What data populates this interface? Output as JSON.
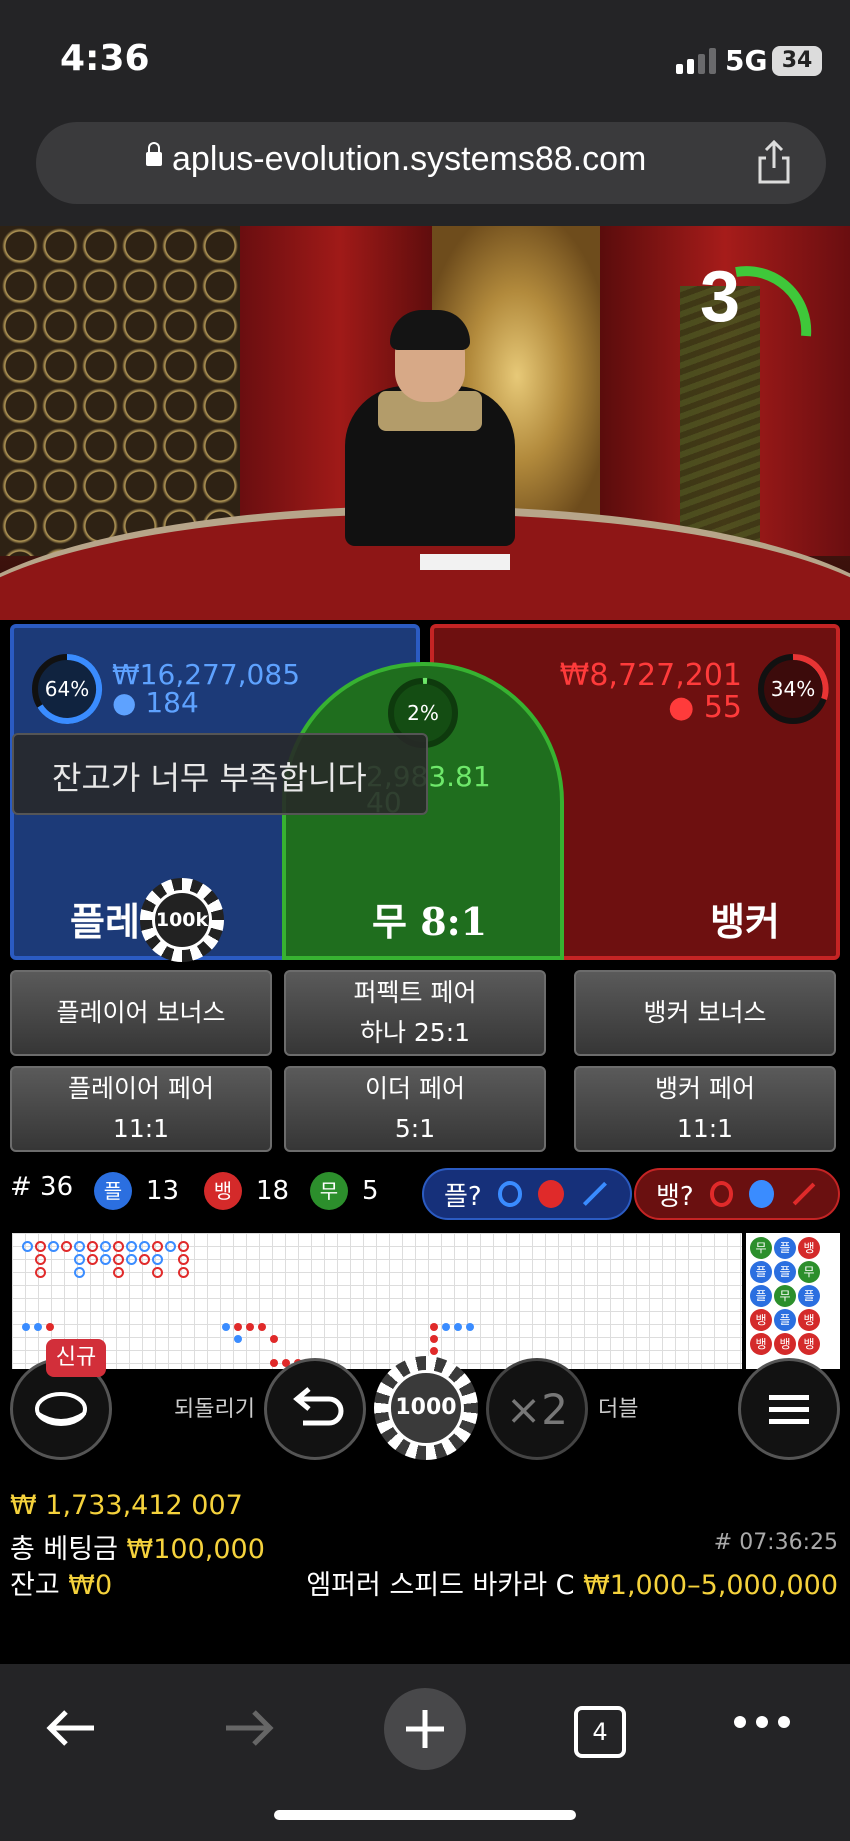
{
  "status": {
    "time": "4:36",
    "network": "5G",
    "battery": "34"
  },
  "browser": {
    "url": "aplus-evolution.systems88.com",
    "tabs_count": "4"
  },
  "game": {
    "countdown": "3",
    "player": {
      "percent": "64%",
      "amount": "₩16,277,085",
      "players": "184",
      "label": "플레이어"
    },
    "banker": {
      "percent": "34%",
      "amount": "₩8,727,201",
      "players": "55",
      "label": "뱅커"
    },
    "tie": {
      "percent": "2%",
      "amount_partial": "2,983.81",
      "players_partial": "40",
      "label": "무 8:1"
    },
    "toast": "잔고가 너무 부족합니다",
    "placed_chip": "100k"
  },
  "side_bets": {
    "player_bonus": "플레이어 보너스",
    "perfect_pair": [
      "퍼펙트 페어",
      "하나 25:1"
    ],
    "banker_bonus": "뱅커 보너스",
    "player_pair": [
      "플레이어 페어",
      "11:1"
    ],
    "either_pair": [
      "이더 페어",
      "5:1"
    ],
    "banker_pair": [
      "뱅커 페어",
      "11:1"
    ]
  },
  "stats": {
    "round": "# 36",
    "player_badge": "플",
    "player_count": "13",
    "banker_badge": "뱅",
    "banker_count": "18",
    "tie_badge": "무",
    "tie_count": "5",
    "player_predict": "플?",
    "banker_predict": "뱅?"
  },
  "controls": {
    "new_badge": "신규",
    "undo_label": "되돌리기",
    "chip_value": "1000",
    "double_symbol": "×2",
    "double_label": "더블"
  },
  "info": {
    "jackpot": "₩ 1,733,412 007",
    "total_bet_label": "총 베팅금",
    "total_bet": "₩100,000",
    "balance_label": "잔고",
    "balance": "₩0",
    "game_id": "# 07:36:25",
    "table_name": "엠퍼러 스피드 바카라 C",
    "limits": "₩1,000–5,000,000"
  },
  "colors": {
    "player": "#2b5bc2",
    "banker": "#c42424",
    "tie": "#37b231",
    "accent": "#f5d23c"
  }
}
